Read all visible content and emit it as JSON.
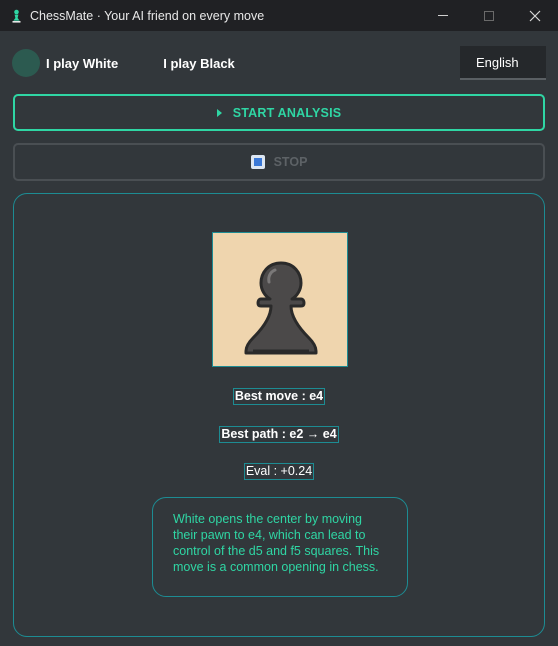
{
  "window": {
    "title": "ChessMate · Your AI friend on every move",
    "app_icon": "pawn-icon",
    "controls": [
      "minimize-icon",
      "maximize-icon",
      "close-icon"
    ]
  },
  "side_selector": {
    "white_label": "I play White",
    "black_label": "I play Black"
  },
  "language": {
    "selected": "English"
  },
  "buttons": {
    "start_label": "START ANALYSIS",
    "stop_label": "STOP"
  },
  "analysis": {
    "piece_icon": "black-pawn-icon",
    "best_move": "Best move : e4",
    "best_path": "Best path : e2 → e4",
    "eval": "Eval : +0.24",
    "explanation": "White opens the center by moving their pawn to e4, which can lead to control of the d5 and f5 squares. This move is a common opening in chess."
  },
  "colors": {
    "accent": "#2fd6a4",
    "panel_border": "#1d8c93",
    "background": "#32373b",
    "titlebar": "#202124",
    "piece_square": "#efd5ae"
  }
}
